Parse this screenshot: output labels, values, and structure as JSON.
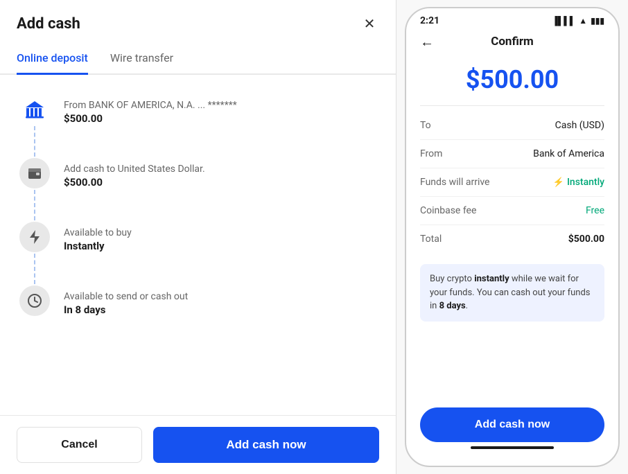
{
  "left": {
    "title": "Add cash",
    "tabs": [
      {
        "label": "Online deposit",
        "active": true
      },
      {
        "label": "Wire transfer",
        "active": false
      }
    ],
    "steps": [
      {
        "icon_type": "bank",
        "label": "From BANK OF AMERICA, N.A. ... *******",
        "value": "$500.00"
      },
      {
        "icon_type": "wallet",
        "label": "Add cash to United States Dollar.",
        "value": "$500.00"
      },
      {
        "icon_type": "bolt",
        "label": "Available to buy",
        "value": "Instantly"
      },
      {
        "icon_type": "clock",
        "label": "Available to send or cash out",
        "value": "In 8 days"
      }
    ],
    "footer": {
      "cancel_label": "Cancel",
      "add_cash_label": "Add cash now"
    }
  },
  "right": {
    "status_time": "2:21",
    "nav_title": "Confirm",
    "confirm_amount": "$500.00",
    "details": [
      {
        "label": "To",
        "value": "Cash (USD)",
        "type": "normal"
      },
      {
        "label": "From",
        "value": "Bank of America",
        "type": "normal"
      },
      {
        "label": "Funds will arrive",
        "value": "Instantly",
        "type": "green"
      },
      {
        "label": "Coinbase fee",
        "value": "Free",
        "type": "green"
      },
      {
        "label": "Total",
        "value": "$500.00",
        "type": "bold"
      }
    ],
    "info_text_part1": "Buy crypto ",
    "info_bold1": "instantly",
    "info_text_part2": " while we wait for your funds. You can cash out your funds in ",
    "info_bold2": "8 days",
    "info_text_part3": ".",
    "add_cash_label": "Add cash now"
  }
}
